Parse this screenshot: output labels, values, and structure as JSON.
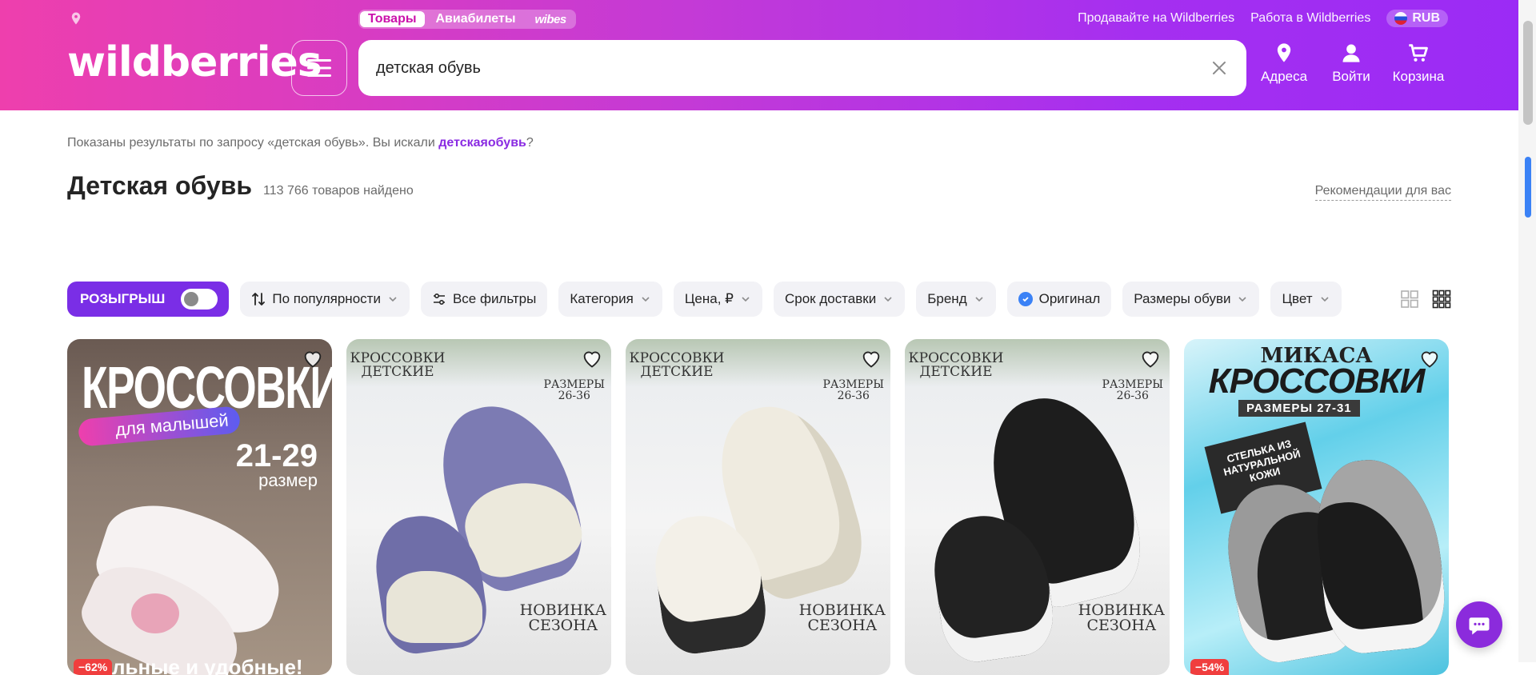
{
  "header": {
    "logo": "wildberries",
    "tabs": [
      {
        "label": "Товары",
        "active": true
      },
      {
        "label": "Авиабилеты",
        "active": false
      },
      {
        "label": "wibes",
        "active": false
      }
    ],
    "links": {
      "sell": "Продавайте на Wildberries",
      "jobs": "Работа в Wildberries",
      "currency": "RUB"
    },
    "search": {
      "value": "детская обувь",
      "clear_icon": "close-icon"
    },
    "actions": {
      "addresses": "Адреса",
      "login": "Войти",
      "cart": "Корзина"
    },
    "colors": {
      "gradient_start": "#ee3fad",
      "gradient_end": "#9b2bf5",
      "accent": "#7a2ee6"
    }
  },
  "results": {
    "notice_prefix": "Показаны результаты по запросу «детская обувь». Вы искали ",
    "notice_link": "детскаяобувь",
    "notice_suffix": "?",
    "title": "Детская обувь",
    "count": "113 766 товаров найдено",
    "recommendations": "Рекомендации для вас"
  },
  "filters": {
    "raffle": "РОЗЫГРЫШ",
    "sort": "По популярности",
    "all_filters": "Все фильтры",
    "category": "Категория",
    "price": "Цена, ₽",
    "delivery": "Срок доставки",
    "brand": "Бренд",
    "original": "Оригинал",
    "sizes": "Размеры обуви",
    "color": "Цвет"
  },
  "products": [
    {
      "banner_title": "КРОССОВКИ",
      "pill": "для малышей",
      "size_range": "21-29",
      "size_label": "размер",
      "bottom_text": "ильные и удобные!",
      "discount": "−62%"
    },
    {
      "label_tl": "КРОССОВКИ ДЕТСКИЕ",
      "label_tr_1": "РАЗМЕРЫ",
      "label_tr_2": "26-36",
      "label_br_1": "НОВИНКА",
      "label_br_2": "СЕЗОНА",
      "shoe_color": "#7c7bb3"
    },
    {
      "label_tl": "КРОССОВКИ ДЕТСКИЕ",
      "label_tr_1": "РАЗМЕРЫ",
      "label_tr_2": "26-36",
      "label_br_1": "НОВИНКА",
      "label_br_2": "СЕЗОНА",
      "shoe_color": "#efebe0"
    },
    {
      "label_tl": "КРОССОВКИ ДЕТСКИЕ",
      "label_tr_1": "РАЗМЕРЫ",
      "label_tr_2": "26-36",
      "label_br_1": "НОВИНКА",
      "label_br_2": "СЕЗОНА",
      "shoe_color": "#1d1d1d"
    },
    {
      "brand": "МИКАСА",
      "banner_title": "КРОССОВКИ",
      "band": "РАЗМЕРЫ 27-31",
      "stamp": "СТЕЛЬКА ИЗ НАТУРАЛЬНОЙ КОЖИ",
      "discount": "−54%"
    }
  ]
}
